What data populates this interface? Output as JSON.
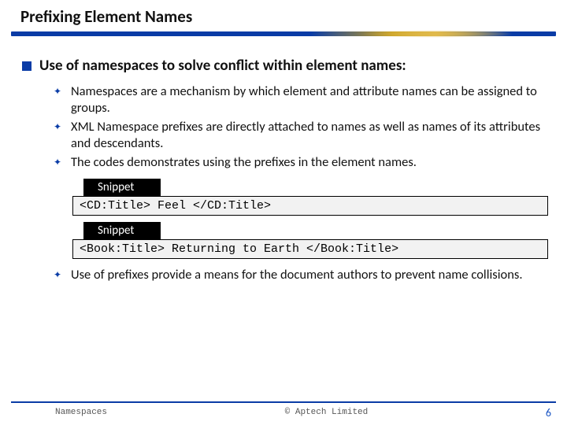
{
  "title": "Prefixing Element Names",
  "main_point": "Use of namespaces to solve conflict within element names:",
  "subpoints": [
    "Namespaces are a mechanism by which element and attribute names can be assigned to groups.",
    "XML Namespace prefixes are directly attached to names as well as names of its attributes and descendants.",
    "The codes demonstrates using the prefixes in the element names."
  ],
  "snippet_label": "Snippet",
  "snippets": [
    "<CD:Title> Feel </CD:Title>",
    "<Book:Title> Returning to Earth </Book:Title>"
  ],
  "closing_point": "Use of prefixes provide a means for the document authors to prevent name collisions.",
  "footer": {
    "left": "Namespaces",
    "center": "© Aptech Limited",
    "right": "6"
  },
  "colors": {
    "accent": "#0a3ca6",
    "gold": "#e0b94a",
    "codebg": "#f2f2f2"
  }
}
